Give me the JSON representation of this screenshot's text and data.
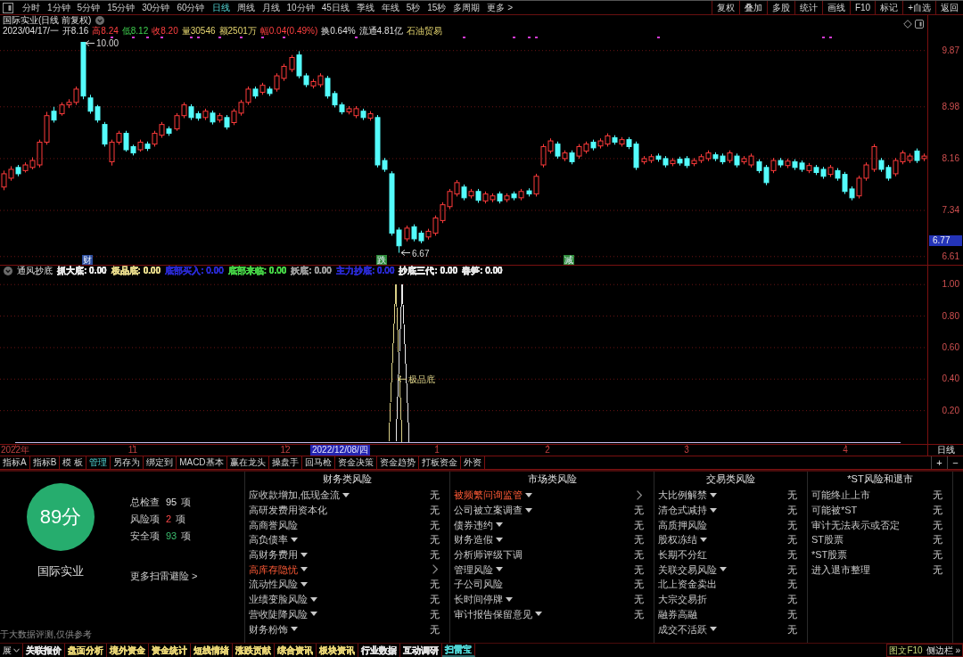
{
  "toolbar": {
    "periods": [
      {
        "label": "分时",
        "selected": false
      },
      {
        "label": "1分钟",
        "selected": false
      },
      {
        "label": "5分钟",
        "selected": false
      },
      {
        "label": "15分钟",
        "selected": false
      },
      {
        "label": "30分钟",
        "selected": false
      },
      {
        "label": "60分钟",
        "selected": false
      },
      {
        "label": "日线",
        "selected": true
      },
      {
        "label": "周线",
        "selected": false
      },
      {
        "label": "月线",
        "selected": false
      },
      {
        "label": "10分钟",
        "selected": false
      },
      {
        "label": "45日线",
        "selected": false
      },
      {
        "label": "季线",
        "selected": false
      },
      {
        "label": "年线",
        "selected": false
      },
      {
        "label": "5秒",
        "selected": false
      },
      {
        "label": "15秒",
        "selected": false
      },
      {
        "label": "多周期",
        "selected": false
      },
      {
        "label": "更多 >",
        "selected": false
      }
    ],
    "buttons": [
      "复权",
      "叠加",
      "多股",
      "统计",
      "画线",
      "F10",
      "标记",
      "+自选",
      "返回"
    ]
  },
  "chart": {
    "title": "国际实业(日线 前复权)",
    "quote": {
      "date": "2023/04/17/一",
      "fields": [
        {
          "text": "开8.16",
          "kind": "neutral"
        },
        {
          "text": "高8.24",
          "kind": "rise"
        },
        {
          "text": "低8.12",
          "kind": "fall"
        },
        {
          "text": "收8.20",
          "kind": "rise"
        },
        {
          "text": "量30546",
          "kind": "volume"
        },
        {
          "text": "额2501万",
          "kind": "volume"
        },
        {
          "text": "幅0.04(0.49%)",
          "kind": "rise"
        },
        {
          "text": "换0.64%",
          "kind": "neutral"
        },
        {
          "text": "流通4.81亿",
          "kind": "neutral"
        },
        {
          "text": "石油贸易",
          "kind": "volume"
        }
      ]
    },
    "max_label": "10.00",
    "min_label": "6.67",
    "cursor_price": "6.77",
    "event_tags": [
      {
        "label": "财",
        "color": "#2b4c9c"
      },
      {
        "label": "跌",
        "color": "#2e8b3a"
      },
      {
        "label": "减",
        "color": "#2e8b3a"
      }
    ],
    "indicator_name": "通风抄底",
    "indicator_legend": [
      {
        "label": "抓大底: 0.00",
        "color": "#e8e8e8"
      },
      {
        "label": "极品底: 0.00",
        "color": "#e6d98a"
      },
      {
        "label": "底部买入: 0.00",
        "color": "#2a2ad0"
      },
      {
        "label": "底部来临: 0.00",
        "color": "#46d246"
      },
      {
        "label": "妖底: 0.00",
        "color": "#9a9a9a"
      },
      {
        "label": "主力抄底: 0.00",
        "color": "#2a2ad0"
      },
      {
        "label": "抄底三代: 0.00",
        "color": "#e8e8e8"
      },
      {
        "label": "春笋: 0.00",
        "color": "#e8e8e8"
      }
    ],
    "cursor_date": "2022/12/08/四",
    "period": "日线",
    "chart_data": [
      {
        "type": "candlestick",
        "ylim": [
          6.48,
          10.43
        ],
        "yticks": [
          {
            "value": 6.61,
            "label": "6.61"
          },
          {
            "value": 7.34,
            "label": "7.34"
          },
          {
            "value": 8.16,
            "label": "8.16"
          },
          {
            "value": 8.98,
            "label": "8.98"
          },
          {
            "value": 9.87,
            "label": "9.87"
          }
        ],
        "grid": true,
        "ohlc": [
          [
            7.71,
            7.97,
            7.66,
            7.92
          ],
          [
            7.85,
            8.04,
            7.81,
            7.99
          ],
          [
            8.02,
            8.06,
            7.88,
            7.92
          ],
          [
            7.97,
            8.1,
            7.94,
            8.06
          ],
          [
            8.02,
            8.18,
            7.99,
            8.13
          ],
          [
            8.06,
            8.46,
            8.02,
            8.42
          ],
          [
            8.42,
            8.9,
            8.38,
            8.84
          ],
          [
            8.91,
            8.98,
            8.73,
            8.77
          ],
          [
            8.87,
            9.05,
            8.84,
            9.01
          ],
          [
            9.01,
            9.1,
            8.96,
            9.05
          ],
          [
            9.05,
            9.3,
            9.01,
            9.26
          ],
          [
            10.0,
            10.0,
            9.1,
            9.15
          ],
          [
            9.12,
            9.17,
            8.87,
            8.91
          ],
          [
            8.98,
            9.01,
            8.73,
            8.77
          ],
          [
            8.7,
            8.74,
            8.35,
            8.39
          ],
          [
            8.11,
            8.46,
            8.05,
            8.42
          ],
          [
            8.42,
            8.6,
            8.38,
            8.56
          ],
          [
            8.56,
            8.6,
            8.27,
            8.3
          ],
          [
            8.35,
            8.38,
            8.21,
            8.25
          ],
          [
            8.3,
            8.46,
            8.27,
            8.42
          ],
          [
            8.39,
            8.43,
            8.28,
            8.32
          ],
          [
            8.39,
            8.6,
            8.35,
            8.56
          ],
          [
            8.53,
            8.74,
            8.49,
            8.7
          ],
          [
            8.63,
            8.67,
            8.52,
            8.56
          ],
          [
            8.63,
            8.88,
            8.6,
            8.84
          ],
          [
            8.84,
            9.05,
            8.8,
            9.01
          ],
          [
            8.98,
            9.02,
            8.77,
            8.81
          ],
          [
            8.87,
            8.91,
            8.76,
            8.8
          ],
          [
            8.81,
            8.95,
            8.77,
            8.91
          ],
          [
            8.88,
            8.92,
            8.7,
            8.74
          ],
          [
            8.77,
            8.88,
            8.73,
            8.84
          ],
          [
            8.81,
            8.85,
            8.62,
            8.66
          ],
          [
            8.73,
            8.95,
            8.69,
            8.91
          ],
          [
            8.88,
            9.09,
            8.84,
            9.05
          ],
          [
            9.05,
            9.3,
            9.01,
            9.26
          ],
          [
            9.26,
            9.3,
            9.11,
            9.15
          ],
          [
            9.21,
            9.36,
            9.17,
            9.32
          ],
          [
            9.26,
            9.3,
            9.15,
            9.19
          ],
          [
            9.26,
            9.51,
            9.22,
            9.47
          ],
          [
            9.43,
            9.66,
            9.39,
            9.62
          ],
          [
            9.57,
            9.8,
            9.53,
            9.76
          ],
          [
            9.8,
            9.86,
            9.43,
            9.47
          ],
          [
            9.47,
            9.51,
            9.29,
            9.33
          ],
          [
            9.31,
            9.42,
            9.27,
            9.38
          ],
          [
            9.33,
            9.51,
            9.29,
            9.47
          ],
          [
            9.43,
            9.47,
            9.11,
            9.15
          ],
          [
            9.19,
            9.23,
            8.97,
            9.01
          ],
          [
            9.01,
            9.05,
            8.86,
            8.9
          ],
          [
            8.9,
            8.99,
            8.86,
            8.95
          ],
          [
            8.84,
            8.99,
            8.8,
            8.95
          ],
          [
            8.91,
            8.95,
            8.77,
            8.81
          ],
          [
            8.8,
            8.91,
            8.76,
            8.87
          ],
          [
            8.81,
            8.85,
            8.02,
            8.06
          ],
          [
            8.13,
            8.17,
            7.95,
            7.99
          ],
          [
            7.92,
            7.96,
            6.94,
            6.98
          ],
          [
            7.03,
            7.07,
            6.67,
            6.78
          ],
          [
            6.89,
            7.1,
            6.85,
            7.06
          ],
          [
            7.08,
            7.12,
            6.85,
            6.89
          ],
          [
            6.98,
            7.02,
            6.82,
            6.86
          ],
          [
            6.92,
            7.05,
            6.88,
            7.01
          ],
          [
            6.98,
            7.26,
            6.94,
            7.22
          ],
          [
            7.18,
            7.47,
            7.14,
            7.43
          ],
          [
            7.4,
            7.68,
            7.36,
            7.64
          ],
          [
            7.6,
            7.82,
            7.56,
            7.78
          ],
          [
            7.71,
            7.75,
            7.5,
            7.54
          ],
          [
            7.57,
            7.68,
            7.53,
            7.64
          ],
          [
            7.64,
            7.68,
            7.46,
            7.5
          ],
          [
            7.49,
            7.64,
            7.45,
            7.6
          ],
          [
            7.51,
            7.61,
            7.47,
            7.57
          ],
          [
            7.6,
            7.64,
            7.45,
            7.49
          ],
          [
            7.51,
            7.61,
            7.47,
            7.57
          ],
          [
            7.6,
            7.64,
            7.5,
            7.54
          ],
          [
            7.54,
            7.68,
            7.5,
            7.64
          ],
          [
            7.65,
            7.69,
            7.56,
            7.6
          ],
          [
            7.6,
            7.92,
            7.56,
            7.88
          ],
          [
            8.06,
            8.39,
            8.02,
            8.35
          ],
          [
            8.28,
            8.48,
            8.24,
            8.44
          ],
          [
            8.39,
            8.43,
            8.16,
            8.2
          ],
          [
            8.16,
            8.29,
            8.12,
            8.25
          ],
          [
            8.25,
            8.29,
            8.07,
            8.11
          ],
          [
            8.2,
            8.39,
            8.16,
            8.35
          ],
          [
            8.28,
            8.43,
            8.24,
            8.39
          ],
          [
            8.42,
            8.46,
            8.29,
            8.33
          ],
          [
            8.36,
            8.48,
            8.32,
            8.44
          ],
          [
            8.39,
            8.56,
            8.35,
            8.52
          ],
          [
            8.49,
            8.53,
            8.38,
            8.42
          ],
          [
            8.39,
            8.5,
            8.35,
            8.46
          ],
          [
            8.46,
            8.5,
            8.31,
            8.35
          ],
          [
            8.39,
            8.43,
            7.98,
            8.02
          ],
          [
            8.11,
            8.2,
            8.07,
            8.16
          ],
          [
            8.13,
            8.23,
            8.09,
            8.19
          ],
          [
            8.2,
            8.24,
            8.11,
            8.15
          ],
          [
            8.16,
            8.2,
            8.02,
            8.06
          ],
          [
            8.08,
            8.17,
            8.04,
            8.13
          ],
          [
            8.15,
            8.19,
            8.05,
            8.09
          ],
          [
            8.16,
            8.2,
            8.01,
            8.05
          ],
          [
            8.08,
            8.17,
            8.04,
            8.13
          ],
          [
            8.13,
            8.23,
            8.09,
            8.19
          ],
          [
            8.16,
            8.29,
            8.12,
            8.25
          ],
          [
            8.22,
            8.26,
            8.12,
            8.16
          ],
          [
            8.2,
            8.24,
            8.07,
            8.11
          ],
          [
            8.13,
            8.29,
            8.09,
            8.25
          ],
          [
            8.2,
            8.24,
            8.02,
            8.06
          ],
          [
            8.11,
            8.2,
            8.07,
            8.16
          ],
          [
            8.06,
            8.24,
            8.02,
            8.2
          ],
          [
            8.11,
            8.15,
            7.93,
            7.97
          ],
          [
            8.02,
            8.06,
            7.74,
            7.78
          ],
          [
            7.97,
            8.17,
            7.93,
            8.13
          ],
          [
            8.13,
            8.17,
            8.02,
            8.06
          ],
          [
            8.05,
            8.16,
            8.01,
            8.12
          ],
          [
            8.11,
            8.15,
            7.98,
            8.02
          ],
          [
            8.09,
            8.13,
            7.95,
            7.99
          ],
          [
            7.97,
            8.09,
            7.93,
            8.05
          ],
          [
            8.02,
            8.06,
            7.9,
            7.94
          ],
          [
            7.99,
            8.03,
            7.84,
            7.88
          ],
          [
            7.91,
            8.06,
            7.87,
            8.02
          ],
          [
            7.97,
            8.01,
            7.81,
            7.85
          ],
          [
            7.91,
            7.95,
            7.6,
            7.64
          ],
          [
            7.68,
            7.72,
            7.5,
            7.54
          ],
          [
            7.57,
            7.89,
            7.53,
            7.85
          ],
          [
            7.85,
            8.1,
            7.81,
            8.06
          ],
          [
            7.99,
            8.39,
            7.95,
            8.35
          ],
          [
            8.13,
            8.17,
            7.95,
            7.99
          ],
          [
            8.02,
            8.06,
            7.81,
            7.85
          ],
          [
            7.92,
            8.17,
            7.88,
            8.13
          ],
          [
            8.11,
            8.29,
            8.07,
            8.25
          ],
          [
            8.13,
            8.24,
            8.09,
            8.2
          ],
          [
            8.28,
            8.32,
            8.09,
            8.13
          ],
          [
            8.16,
            8.24,
            8.12,
            8.2
          ]
        ]
      },
      {
        "type": "line",
        "ylim": [
          0,
          1.12
        ],
        "yticks": [
          {
            "value": 0.2,
            "label": "0.20"
          },
          {
            "value": 0.4,
            "label": "0.40"
          },
          {
            "value": 0.6,
            "label": "0.60"
          },
          {
            "value": 0.8,
            "label": "0.80"
          },
          {
            "value": 1,
            "label": "1.00"
          }
        ],
        "grid": true,
        "categories": [
          "2022年",
          null,
          null,
          null,
          null,
          null,
          null,
          null,
          null,
          null,
          null,
          null,
          null,
          null,
          null,
          null,
          null,
          "11",
          null,
          null,
          null,
          null,
          null,
          null,
          null,
          null,
          null,
          null,
          null,
          null,
          null,
          null,
          null,
          null,
          null,
          null,
          null,
          null,
          null,
          "12",
          null,
          null,
          null,
          null,
          null,
          null,
          null,
          null,
          null,
          null,
          null,
          null,
          null,
          null,
          null,
          null,
          null,
          null,
          null,
          null,
          null,
          "1",
          null,
          null,
          null,
          null,
          null,
          null,
          null,
          null,
          null,
          null,
          null,
          null,
          null,
          null,
          null,
          "2",
          null,
          null,
          null,
          null,
          null,
          null,
          null,
          null,
          null,
          null,
          null,
          null,
          null,
          null,
          null,
          null,
          null,
          null,
          null,
          "3",
          null,
          null,
          null,
          null,
          null,
          null,
          null,
          null,
          null,
          null,
          null,
          null,
          null,
          null,
          null,
          null,
          null,
          null,
          null,
          null,
          null,
          null,
          "4",
          null,
          null,
          null,
          null,
          null,
          null,
          null,
          null
        ],
        "series": [
          {
            "color": "#c4c0f0",
            "values": [
              0,
              0,
              0,
              0,
              0,
              0,
              0,
              0,
              0,
              0,
              0,
              0,
              0,
              0,
              0,
              0,
              0,
              0,
              0,
              0,
              0,
              0,
              0,
              0,
              0,
              0,
              0,
              0,
              0,
              0,
              0,
              0,
              0,
              0,
              0,
              0,
              0,
              0,
              0,
              0,
              0,
              0,
              0,
              0,
              0,
              0,
              0,
              0,
              0,
              0,
              0,
              0,
              0,
              0,
              null,
              null,
              null,
              null,
              0,
              0,
              0,
              0,
              0,
              0,
              0,
              0,
              0,
              0,
              0,
              0,
              0,
              0,
              0,
              0,
              0,
              0,
              0,
              0,
              0,
              0,
              0,
              0,
              0,
              0,
              0,
              0,
              0,
              0,
              0,
              0,
              0,
              0,
              0,
              0,
              0,
              0,
              0,
              0,
              0,
              0,
              0,
              0,
              0,
              0,
              0,
              0,
              0,
              0,
              0,
              0,
              0,
              0,
              0,
              0,
              0,
              0,
              0,
              0,
              0,
              0,
              0,
              0,
              0,
              0,
              0,
              0,
              0,
              0,
              0
            ]
          },
          {
            "color": "#d9cf86",
            "values": [
              null,
              null,
              null,
              null,
              null,
              null,
              null,
              null,
              null,
              null,
              null,
              null,
              null,
              null,
              null,
              null,
              null,
              null,
              null,
              null,
              null,
              null,
              null,
              null,
              null,
              null,
              null,
              null,
              null,
              null,
              null,
              null,
              null,
              null,
              null,
              null,
              null,
              null,
              null,
              null,
              null,
              null,
              null,
              null,
              null,
              null,
              null,
              null,
              null,
              null,
              null,
              null,
              null,
              null,
              0,
              1,
              0,
              null,
              null,
              null,
              null,
              null,
              null,
              null,
              null,
              null,
              null,
              null,
              null,
              null,
              null,
              null,
              null,
              null,
              null,
              null,
              null,
              null,
              null,
              null,
              null,
              null,
              null,
              null,
              null,
              null,
              null,
              null,
              null,
              null,
              null,
              null,
              null,
              null,
              null,
              null,
              null,
              null,
              null,
              null,
              null,
              null,
              null,
              null,
              null,
              null,
              null,
              null,
              null,
              null,
              null,
              null,
              null,
              null,
              null,
              null,
              null,
              null,
              null,
              null,
              null,
              null,
              null,
              null,
              null,
              null,
              null,
              null,
              null
            ]
          },
          {
            "color": "#e8e8e8",
            "values": [
              null,
              null,
              null,
              null,
              null,
              null,
              null,
              null,
              null,
              null,
              null,
              null,
              null,
              null,
              null,
              null,
              null,
              null,
              null,
              null,
              null,
              null,
              null,
              null,
              null,
              null,
              null,
              null,
              null,
              null,
              null,
              null,
              null,
              null,
              null,
              null,
              null,
              null,
              null,
              null,
              null,
              null,
              null,
              null,
              null,
              null,
              null,
              null,
              null,
              null,
              null,
              null,
              null,
              null,
              null,
              0,
              1,
              0,
              null,
              null,
              null,
              null,
              null,
              null,
              null,
              null,
              null,
              null,
              null,
              null,
              null,
              null,
              null,
              null,
              null,
              null,
              null,
              null,
              null,
              null,
              null,
              null,
              null,
              null,
              null,
              null,
              null,
              null,
              null,
              null,
              null,
              null,
              null,
              null,
              null,
              null,
              null,
              null,
              null,
              null,
              null,
              null,
              null,
              null,
              null,
              null,
              null,
              null,
              null,
              null,
              null,
              null,
              null,
              null,
              null,
              null,
              null,
              null,
              null,
              null,
              null,
              null,
              null,
              null,
              null,
              null,
              null,
              null,
              null
            ]
          }
        ],
        "annotations": [
          "极品底"
        ]
      }
    ]
  },
  "indicator_tabs": {
    "tabs": [
      {
        "label": "指标A",
        "selected": false
      },
      {
        "label": "指标B",
        "selected": false
      },
      {
        "label": "模 板",
        "selected": false
      },
      {
        "label": "管理",
        "selected": true
      },
      {
        "label": "另存为",
        "selected": false
      },
      {
        "label": "绑定到",
        "selected": false
      },
      {
        "label": "MACD基本",
        "selected": false
      },
      {
        "label": "赢在龙头",
        "selected": false
      },
      {
        "label": "操盘手",
        "selected": false
      },
      {
        "label": "回马枪",
        "selected": false
      },
      {
        "label": "资金决策",
        "selected": false
      },
      {
        "label": "资金趋势",
        "selected": false
      },
      {
        "label": "打板资金",
        "selected": false
      },
      {
        "label": "外资",
        "selected": false
      }
    ],
    "zoom_buttons": [
      "+",
      "−"
    ]
  },
  "scan": {
    "score": "89分",
    "stock_name": "国际实业",
    "stats": [
      {
        "label": "总检查",
        "value": "95",
        "unit": "项",
        "kind": "total"
      },
      {
        "label": "风险项",
        "value": "2",
        "unit": "项",
        "kind": "risk"
      },
      {
        "label": "安全项",
        "value": "93",
        "unit": "项",
        "kind": "safe"
      }
    ],
    "more_link": "更多扫雷避险 >",
    "disclaimer": "于大数据评测,仅供参考",
    "categories": [
      {
        "title": "财务类风险",
        "items": [
          {
            "label": "应收款增加,低现金流",
            "expandable": true,
            "risk": false,
            "value": "无"
          },
          {
            "label": "高研发费用资本化",
            "expandable": false,
            "risk": false,
            "value": "无"
          },
          {
            "label": "高商誉风险",
            "expandable": false,
            "risk": false,
            "value": "无"
          },
          {
            "label": "高负债率",
            "expandable": true,
            "risk": false,
            "value": "无"
          },
          {
            "label": "高财务费用",
            "expandable": true,
            "risk": false,
            "value": "无"
          },
          {
            "label": "高库存隐忧",
            "expandable": true,
            "risk": true
          },
          {
            "label": "流动性风险",
            "expandable": true,
            "risk": false,
            "value": "无"
          },
          {
            "label": "业绩变脸风险",
            "expandable": true,
            "risk": false,
            "value": "无"
          },
          {
            "label": "营收陡降风险",
            "expandable": true,
            "risk": false,
            "value": "无"
          },
          {
            "label": "财务粉饰",
            "expandable": true,
            "risk": false,
            "value": "无"
          }
        ]
      },
      {
        "title": "市场类风险",
        "items": [
          {
            "label": "被频繁问询监管",
            "expandable": true,
            "risk": true
          },
          {
            "label": "公司被立案调查",
            "expandable": true,
            "risk": false,
            "value": "无"
          },
          {
            "label": "债券违约",
            "expandable": true,
            "risk": false,
            "value": "无"
          },
          {
            "label": "财务造假",
            "expandable": true,
            "risk": false,
            "value": "无"
          },
          {
            "label": "分析师评级下调",
            "expandable": false,
            "risk": false,
            "value": "无"
          },
          {
            "label": "管理风险",
            "expandable": true,
            "risk": false,
            "value": "无"
          },
          {
            "label": "子公司风险",
            "expandable": false,
            "risk": false,
            "value": "无"
          },
          {
            "label": "长时间停牌",
            "expandable": true,
            "risk": false,
            "value": "无"
          },
          {
            "label": "审计报告保留意见",
            "expandable": true,
            "risk": false,
            "value": "无"
          }
        ]
      },
      {
        "title": "交易类风险",
        "items": [
          {
            "label": "大比例解禁",
            "expandable": true,
            "risk": false,
            "value": "无"
          },
          {
            "label": "清仓式减持",
            "expandable": true,
            "risk": false,
            "value": "无"
          },
          {
            "label": "高质押风险",
            "expandable": false,
            "risk": false,
            "value": "无"
          },
          {
            "label": "股权冻结",
            "expandable": true,
            "risk": false,
            "value": "无"
          },
          {
            "label": "长期不分红",
            "expandable": false,
            "risk": false,
            "value": "无"
          },
          {
            "label": "关联交易风险",
            "expandable": true,
            "risk": false,
            "value": "无"
          },
          {
            "label": "北上资金卖出",
            "expandable": false,
            "risk": false,
            "value": "无"
          },
          {
            "label": "大宗交易折",
            "expandable": false,
            "risk": false,
            "value": "无"
          },
          {
            "label": "融券高融",
            "expandable": false,
            "risk": false,
            "value": "无"
          },
          {
            "label": "成交不活跃",
            "expandable": true,
            "risk": false,
            "value": "无"
          }
        ]
      },
      {
        "title": "*ST风险和退市",
        "items": [
          {
            "label": "可能终止上市",
            "expandable": false,
            "risk": false,
            "value": "无"
          },
          {
            "label": "可能被*ST",
            "expandable": false,
            "risk": false,
            "value": "无"
          },
          {
            "label": "审计无法表示或否定",
            "expandable": false,
            "risk": false,
            "value": "无"
          },
          {
            "label": "ST股票",
            "expandable": false,
            "risk": false,
            "value": "无"
          },
          {
            "label": "*ST股票",
            "expandable": false,
            "risk": false,
            "value": "无"
          },
          {
            "label": "进入退市整理",
            "expandable": false,
            "risk": false,
            "value": "无"
          }
        ]
      }
    ]
  },
  "bottom_tabs": {
    "expand_label": "展",
    "tabs": [
      {
        "label": "关联报价",
        "selected": false,
        "color": "#e0e0e0"
      },
      {
        "label": "盘面分析",
        "selected": false,
        "color": "#e8d474"
      },
      {
        "label": "境外资金",
        "selected": false,
        "color": "#e8d474"
      },
      {
        "label": "资金统计",
        "selected": false,
        "color": "#e8d474"
      },
      {
        "label": "短线情绪",
        "selected": false,
        "color": "#e8d474"
      },
      {
        "label": "涨跌贡献",
        "selected": false,
        "color": "#e8d474"
      },
      {
        "label": "综合资讯",
        "selected": false,
        "color": "#e8d474"
      },
      {
        "label": "板块资讯",
        "selected": false,
        "color": "#e8d474"
      },
      {
        "label": "行业数据",
        "selected": false,
        "color": "#e0e0e0"
      },
      {
        "label": "互动调研",
        "selected": false,
        "color": "#e0e0e0"
      },
      {
        "label": "扫雷宝",
        "selected": true,
        "color": "#4fd6d6"
      }
    ],
    "side_buttons": [
      "图文F10",
      "侧边栏 »"
    ]
  }
}
